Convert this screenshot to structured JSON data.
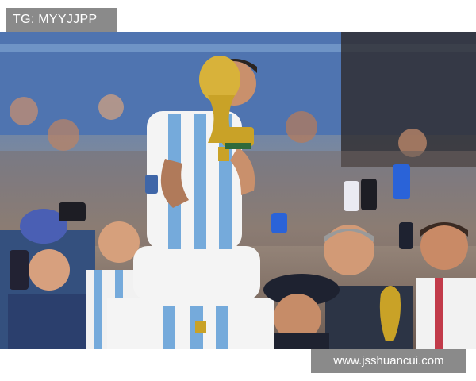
{
  "watermarks": {
    "top_left": "TG: MYYJJPP",
    "bottom_right": "www.jsshuancui.com"
  },
  "photo": {
    "palette": {
      "argentina_sky_blue": "#75aadb",
      "shirt_white": "#f4f4f4",
      "trophy_gold": "#c9a227",
      "crowd_blue": "#3f66a8",
      "skin": "#d9a07c",
      "dark_shirt": "#2c3445",
      "phone_blue": "#2a63d8"
    }
  }
}
